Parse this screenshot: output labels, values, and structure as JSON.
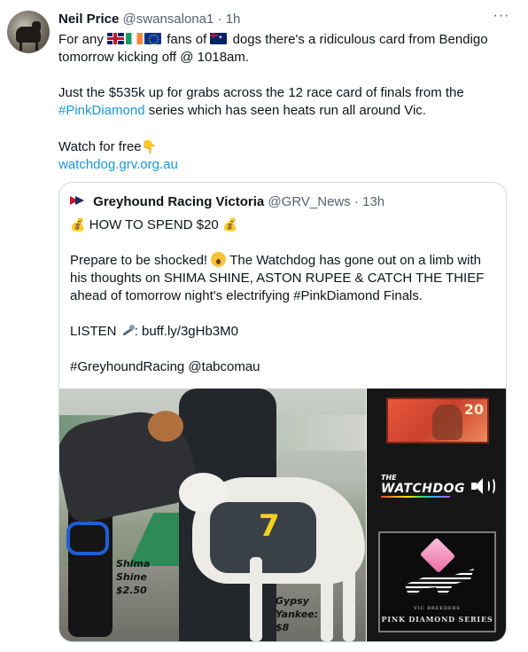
{
  "tweet": {
    "name": "Neil Price",
    "handle": "@swansalona1",
    "separator": "·",
    "time": "1h",
    "more_label": "···",
    "line1_a": "For any",
    "line1_b": "fans of",
    "line1_c": "dogs there's a ridiculous card from Bendigo tomorrow kicking off @ 1018am.",
    "line2_a": "Just the $535k up for grabs across the 12 race card of finals from the",
    "line2_hashtag": "#PinkDiamond",
    "line2_b": "series which has seen heats run all around Vic.",
    "line3": "Watch for free",
    "link": "watchdog.grv.org.au"
  },
  "quote": {
    "name": "Greyhound Racing Victoria",
    "handle": "@GRV_News",
    "separator": "·",
    "time": "13h",
    "title": "HOW TO SPEND $20",
    "para1_a": "Prepare to be shocked!",
    "para1_b": "The Watchdog has gone out on a limb with his thoughts on SHIMA SHINE, ASTON RUPEE & CATCH THE THIEF ahead of tomorrow night's electrifying #PinkDiamond Finals.",
    "listen_label": "LISTEN",
    "listen_link": ": buff.ly/3gHb3M0",
    "tags": "#GreyhoundRacing @tabcomau"
  },
  "media": {
    "caption_left_1": "Shima",
    "caption_left_2": "Shine",
    "caption_left_3": "$2.50",
    "caption_right_1": "Gypsy",
    "caption_right_2": "Yankee:",
    "caption_right_3": "$8",
    "coat_number": "7",
    "note_value": "20",
    "watchdog_the": "THE",
    "watchdog_name": "WATCHDOG",
    "badge_small": "VIC BREEDERS",
    "badge_title": "PINK DIAMOND SERIES"
  },
  "icons": {
    "flags": [
      "uk-flag-icon",
      "ireland-flag-icon",
      "eu-flag-icon",
      "australia-flag-icon"
    ],
    "point": "backhand-point-down-icon",
    "money_bag": "money-bag-icon",
    "shocked": "shocked-face-icon",
    "microphone": "microphone-icon",
    "speaker": "speaker-icon"
  },
  "colors": {
    "link": "#1b95e0",
    "muted": "#536471",
    "border": "#cfd9de"
  }
}
